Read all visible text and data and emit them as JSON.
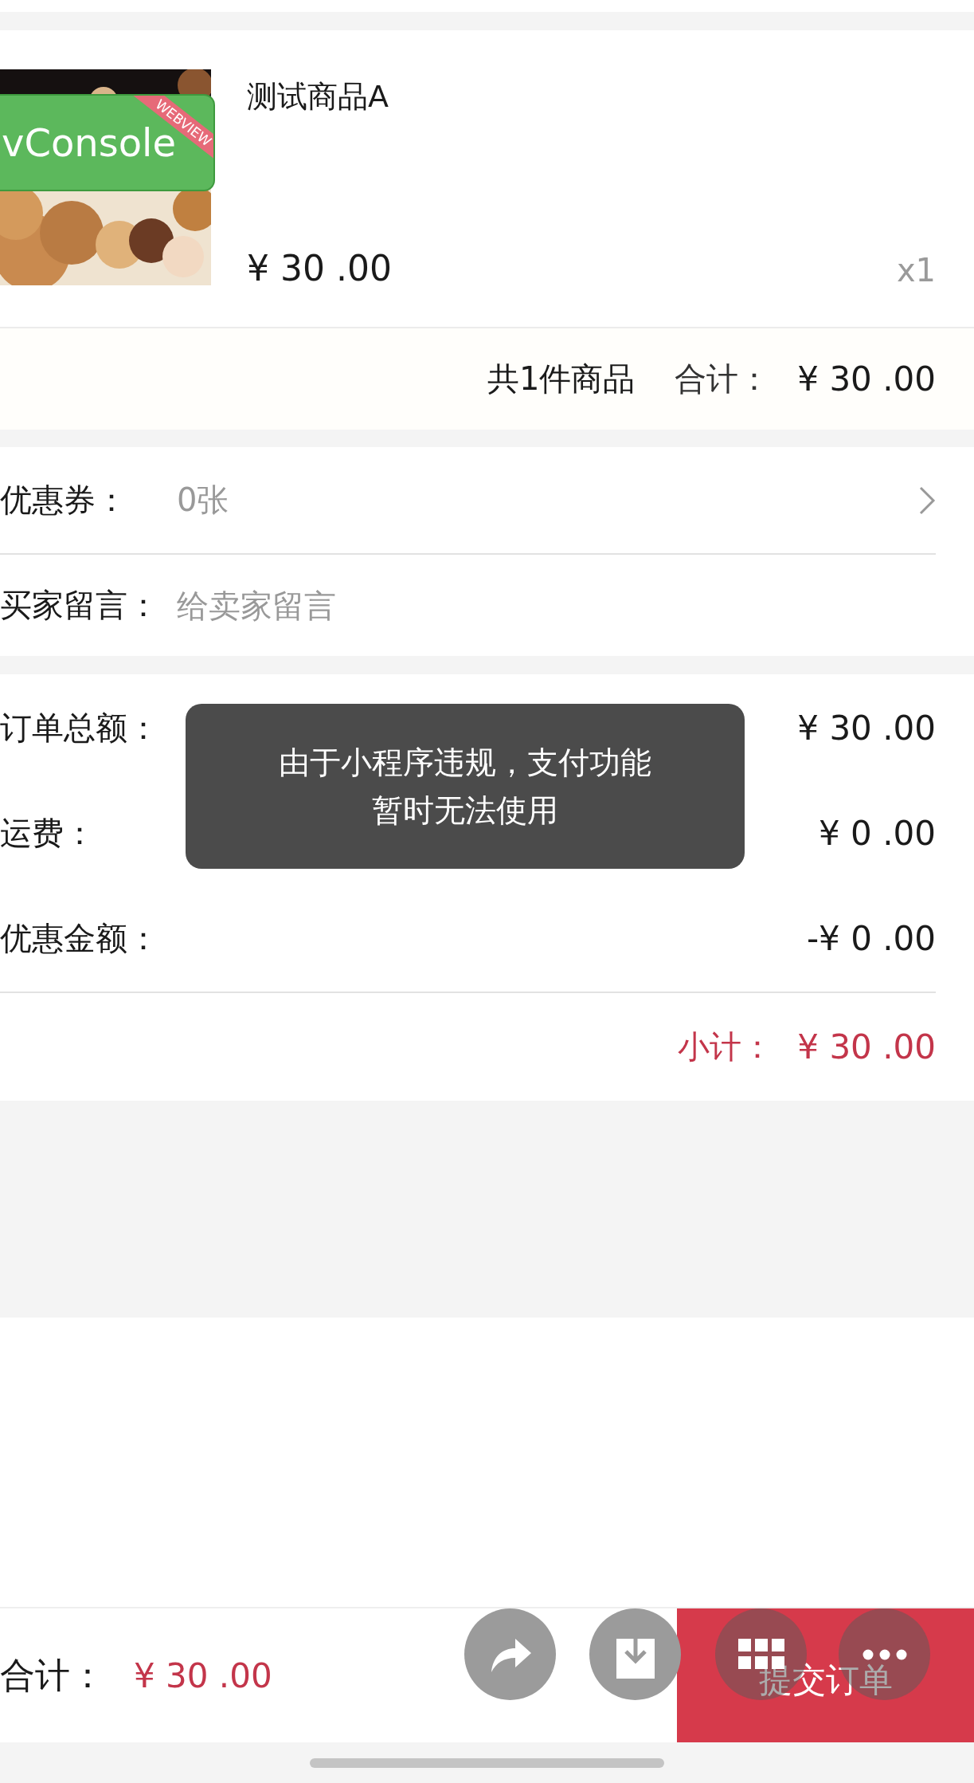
{
  "product": {
    "name": "测试商品A",
    "price": "¥ 30 .00",
    "quantity": "x1"
  },
  "debug_badge": {
    "label": "vConsole",
    "ribbon": "WEBVIEW"
  },
  "order_summary": {
    "count": "共1件商品",
    "total_label": "合计：",
    "total": "¥ 30 .00"
  },
  "coupon": {
    "label": "优惠券：",
    "value": "0张"
  },
  "message": {
    "label": "买家留言：",
    "placeholder": "给卖家留言"
  },
  "amounts": [
    {
      "label": "订单总额：",
      "value": "¥ 30 .00"
    },
    {
      "label": "运费：",
      "value": "¥ 0 .00"
    },
    {
      "label": "优惠金额：",
      "value": "-¥ 0 .00"
    }
  ],
  "subtotal": {
    "label": "小计：",
    "value": "¥ 30 .00"
  },
  "toast": {
    "lines": [
      "由于小程序违规，支付功能",
      "暂时无法使用"
    ]
  },
  "bottom_bar": {
    "total_label": "合计：",
    "total": "¥ 30 .00",
    "submit": "提交订单"
  },
  "floating_actions": [
    {
      "kind": "share"
    },
    {
      "kind": "download"
    },
    {
      "kind": "grid"
    },
    {
      "kind": "more"
    }
  ]
}
